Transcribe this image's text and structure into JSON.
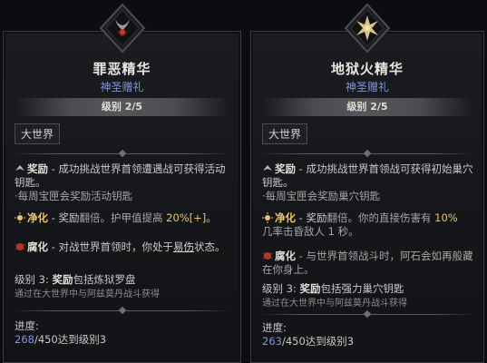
{
  "left": {
    "title": "罪恶精华",
    "subtitle": "神圣赠礼",
    "level": "级别 2/5",
    "region": "大世界",
    "reward_label": "奖励",
    "reward_text": " - 成功挑战世界首领遭遇战可获得活动钥匙。",
    "reward_sub": "·每周宝匣会奖励活动钥匙",
    "purify_label": "净化",
    "purify_text_a": " - 奖励",
    "purify_text_b": "翻倍。护甲值提高 ",
    "purify_value": "20%[+]",
    "purify_end": "。",
    "corrupt_label": "腐化",
    "corrupt_text": " - 对战世界首领时，你处于",
    "corrupt_keyword": "易伤",
    "corrupt_end": "状态。",
    "level3_label": "级别 3: ",
    "level3_bold": "奖励",
    "level3_text": "包括炼狱罗盘",
    "level3_note": "通过在大世界中与阿兹莫丹战斗获得",
    "progress_label": "进度:",
    "progress_value": "268",
    "progress_rest": "/450达到级别3"
  },
  "right": {
    "title": "地狱火精华",
    "subtitle": "神圣赠礼",
    "level": "级别 2/5",
    "region": "大世界",
    "reward_label": "奖励",
    "reward_text": " - 成功挑战世界首领战可获得初始巢穴钥匙。",
    "reward_sub": "·每周宝匣会奖励巢穴钥匙",
    "purify_label": "净化",
    "purify_text_a": " - 奖励",
    "purify_text_b": "翻倍。你的直接伤害有 ",
    "purify_value": "10%",
    "purify_end": "几率击昏敌人 1 秒。",
    "corrupt_label": "腐化",
    "corrupt_text": " - 与世界首领战斗时，阿石会如再般藏在你身上。",
    "level3_label": "级别 3: ",
    "level3_bold": "奖励",
    "level3_text": "包括强力巢穴钥匙",
    "level3_note": "通过在大世界中与阿兹莫丹战斗获得",
    "progress_label": "进度:",
    "progress_value": "263",
    "progress_rest": "/450达到级别3"
  },
  "colors": {
    "accent_blue": "#7f96d8",
    "gold": "#e7c568",
    "bg": "#0b0d10"
  },
  "icons": [
    "demon-emblem-icon",
    "hellfire-emblem-icon",
    "reward-icon",
    "purify-icon",
    "corrupt-icon"
  ]
}
